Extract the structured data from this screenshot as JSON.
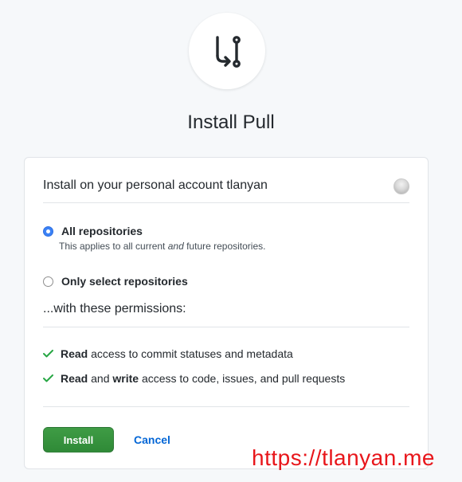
{
  "app": {
    "title": "Install Pull",
    "logo_icon": "git-pull-request-icon"
  },
  "account": {
    "label": "Install on your personal account tlanyan",
    "avatar_icon": "user-avatar"
  },
  "repositories": {
    "options": [
      {
        "label": "All repositories",
        "selected": true
      },
      {
        "label": "Only select repositories",
        "selected": false
      }
    ],
    "all_desc_prefix": "This applies to all current ",
    "all_desc_emphasis": "and",
    "all_desc_suffix": " future repositories."
  },
  "permissions": {
    "heading": "...with these permissions:",
    "items": [
      {
        "strong1": "Read",
        "middle": "",
        "strong2": "",
        "rest": " access to commit statuses and metadata"
      },
      {
        "strong1": "Read",
        "middle": " and ",
        "strong2": "write",
        "rest": " access to code, issues, and pull requests"
      }
    ],
    "check_icon": "check-icon",
    "check_color": "#28a745"
  },
  "actions": {
    "install_label": "Install",
    "cancel_label": "Cancel"
  },
  "colors": {
    "primary_button": "#2ea44f",
    "link": "#0366d6",
    "radio_selected": "#3b82f6",
    "watermark": "#e8161b"
  },
  "watermark": {
    "text": "https://tlanyan.me"
  }
}
